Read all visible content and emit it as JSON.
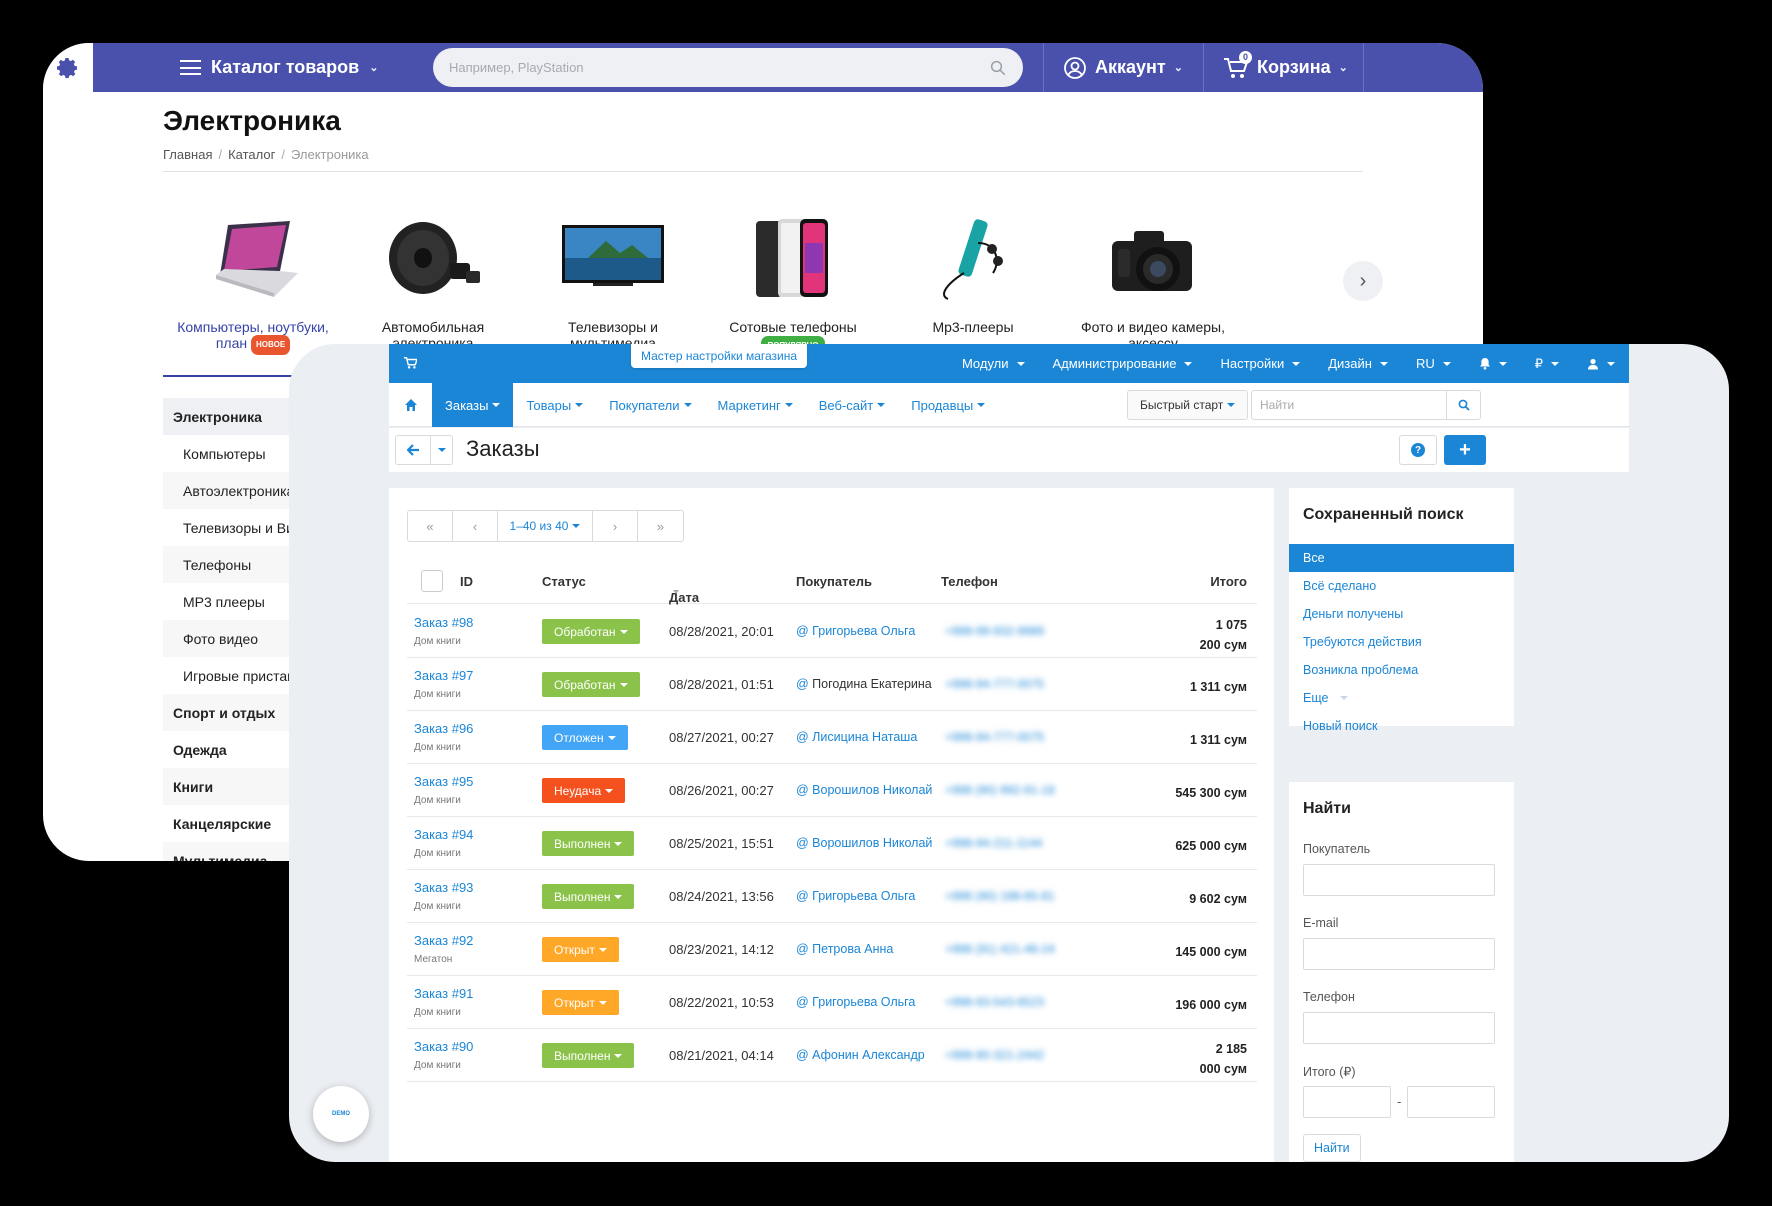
{
  "store": {
    "catalog_label": "Каталог товаров",
    "search_placeholder": "Например, PlayStation",
    "account_label": "Аккаунт",
    "cart_label": "Корзина",
    "cart_count": "0",
    "title": "Электроника",
    "breadcrumb": {
      "home": "Главная",
      "catalog": "Каталог",
      "current": "Электроника"
    },
    "categories": [
      {
        "line1": "Компьютеры, ноутбуки,",
        "line2": "план",
        "badge": "НОВОЕ"
      },
      {
        "line1": "Автомобильная",
        "line2": "электроника"
      },
      {
        "line1": "Телевизоры и",
        "line2": "мультимедиа"
      },
      {
        "line1": "Сотовые телефоны",
        "badge": "ПОПУЛЯРНО"
      },
      {
        "line1": "Mp3-плееры"
      },
      {
        "line1": "Фото и видео камеры,",
        "line2": "аксессу"
      }
    ],
    "sidebar": [
      "Электроника",
      "Компьютеры",
      "Автоэлектроника",
      "Телевизоры и Видео",
      "Телефоны",
      "MP3 плееры",
      "Фото видео",
      "Игровые приставки",
      "Спорт и отдых",
      "Одежда",
      "Книги",
      "Канцелярские",
      "Мультимедиа"
    ]
  },
  "admin": {
    "wizard": "Мастер настройки магазина",
    "top_menu": [
      "Модули",
      "Администрирование",
      "Настройки",
      "Дизайн",
      "RU",
      "₽"
    ],
    "tabs": [
      "Заказы",
      "Товары",
      "Покупатели",
      "Маркетинг",
      "Веб-сайт",
      "Продавцы"
    ],
    "quick_start": "Быстрый старт",
    "find_placeholder": "Найти",
    "page_title": "Заказы",
    "pager": {
      "first": "«",
      "prev": "‹",
      "range": "1–40 из 40",
      "next": "›",
      "last": "»"
    },
    "columns": {
      "id": "ID",
      "status": "Статус",
      "date": "Дата",
      "customer": "Покупатель",
      "phone": "Телефон",
      "total": "Итого"
    },
    "orders": [
      {
        "id": "Заказ #98",
        "shop": "Дом книги",
        "status": "Обработан",
        "date": "08/28/2021, 20:01",
        "customer": "Григорьева Ольга",
        "phone": "+998-99-932-9989",
        "total1": "1 075",
        "total2": "200 сум"
      },
      {
        "id": "Заказ #97",
        "shop": "Дом книги",
        "status": "Обработан",
        "date": "08/28/2021, 01:51",
        "customer": "Погодина Екатерина",
        "phone": "+998-94-777-0075",
        "total1": "1 311 сум",
        "total2": ""
      },
      {
        "id": "Заказ #96",
        "shop": "Дом книги",
        "status": "Отложен",
        "date": "08/27/2021, 00:27",
        "customer": "Лисицина Наташа",
        "phone": "+998-94-777-0075",
        "total1": "1 311 сум",
        "total2": ""
      },
      {
        "id": "Заказ #95",
        "shop": "Дом книги",
        "status": "Неудача",
        "date": "08/26/2021, 00:27",
        "customer": "Ворошилов Николай",
        "phone": "+998 (90) 992-91-18",
        "total1": "545 300 сум",
        "total2": ""
      },
      {
        "id": "Заказ #94",
        "shop": "Дом книги",
        "status": "Выполнен",
        "date": "08/25/2021, 15:51",
        "customer": "Ворошилов Николай",
        "phone": "+998-94-211-1144",
        "total1": "625 000 сум",
        "total2": ""
      },
      {
        "id": "Заказ #93",
        "shop": "Дом книги",
        "status": "Выполнен",
        "date": "08/24/2021, 13:56",
        "customer": "Григорьева Ольга",
        "phone": "+998 (90) 188-65-81",
        "total1": "9 602 сум",
        "total2": ""
      },
      {
        "id": "Заказ #92",
        "shop": "Мегатон",
        "status": "Открыт",
        "date": "08/23/2021, 14:12",
        "customer": "Петрова Анна",
        "phone": "+998 (91) 421-48-24",
        "total1": "145 000 сум",
        "total2": ""
      },
      {
        "id": "Заказ #91",
        "shop": "Дом книги",
        "status": "Открыт",
        "date": "08/22/2021, 10:53",
        "customer": "Григорьева Ольга",
        "phone": "+998-93-543-6523",
        "total1": "196 000 сум",
        "total2": ""
      },
      {
        "id": "Заказ #90",
        "shop": "Дом книги",
        "status": "Выполнен",
        "date": "08/21/2021, 04:14",
        "customer": "Афонин Александр",
        "phone": "+998-90-321-2442",
        "total1": "2 185",
        "total2": "000 сум"
      }
    ],
    "status_colors": {
      "Обработан": "#8bc34a",
      "Отложен": "#42a5f5",
      "Неудача": "#f4511e",
      "Выполнен": "#8bc34a",
      "Открыт": "#ffa726"
    },
    "saved": {
      "title": "Сохраненный поиск",
      "items": [
        "Все",
        "Всё сделано",
        "Деньги получены",
        "Требуются действия",
        "Возникла проблема",
        "Еще",
        "Новый поиск"
      ]
    },
    "find": {
      "title": "Найти",
      "customer": "Покупатель",
      "email": "E-mail",
      "phone": "Телефон",
      "total": "Итого (₽)",
      "dash": "-",
      "button": "Найти"
    },
    "demo": "DEMO"
  }
}
